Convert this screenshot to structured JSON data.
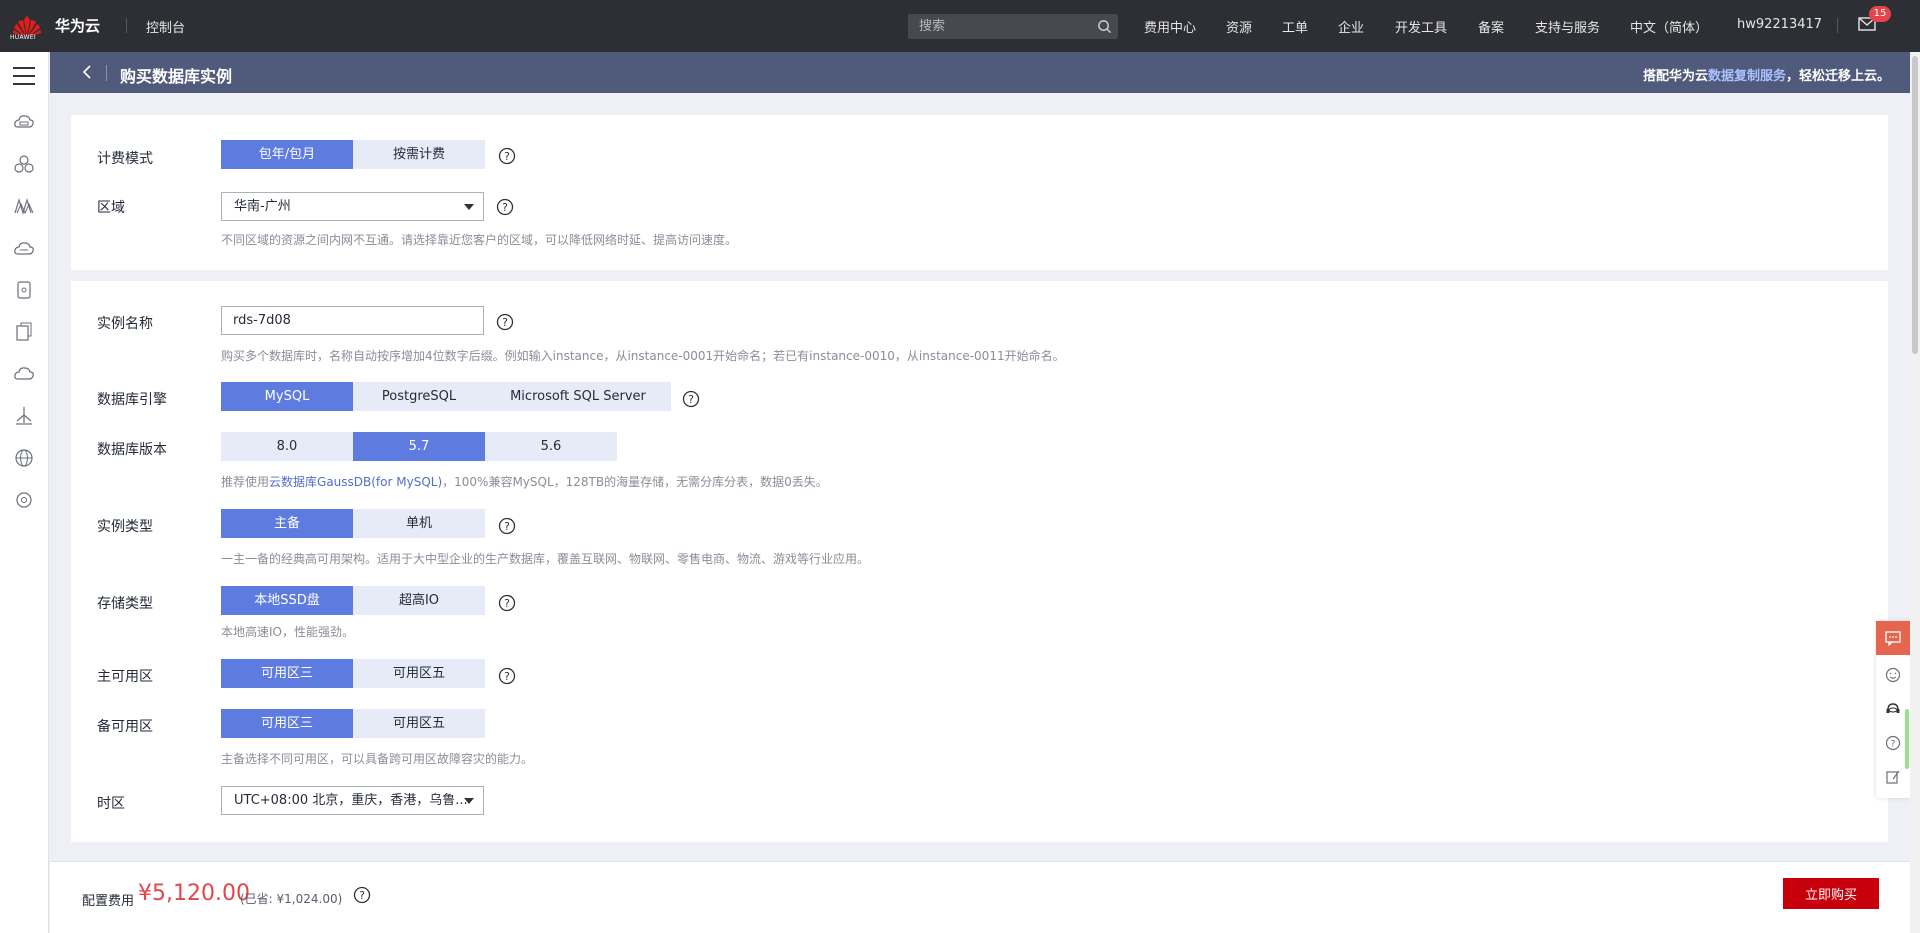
{
  "topbar": {
    "brand": "华为云",
    "logo_text": "HUAWEI",
    "console": "控制台",
    "search_placeholder": "搜索",
    "nav": [
      "费用中心",
      "资源",
      "工单",
      "企业",
      "开发工具",
      "备案",
      "支持与服务",
      "中文（简体）",
      "hw92213417"
    ],
    "mail_count": "15"
  },
  "rail": {
    "icons": [
      "cloud-server-icon",
      "cluster-icon",
      "network-icon",
      "cloud-storage-icon",
      "database-icon",
      "document-icon",
      "cloud-icon",
      "deploy-icon",
      "globe-icon",
      "ai-icon"
    ]
  },
  "page": {
    "title": "购买数据库实例",
    "promo_prefix": "搭配华为云",
    "promo_link": "数据复制服务",
    "promo_suffix": "，轻松迁移上云。"
  },
  "billing": {
    "label": "计费模式",
    "options": [
      "包年/包月",
      "按需计费"
    ],
    "selected": "包年/包月"
  },
  "region": {
    "label": "区域",
    "value": "华南-广州",
    "hint": "不同区域的资源之间内网不互通。请选择靠近您客户的区域，可以降低网络时延、提高访问速度。"
  },
  "instance_name": {
    "label": "实例名称",
    "value": "rds-7d08",
    "hint": "购买多个数据库时，名称自动按序增加4位数字后缀。例如输入instance，从instance-0001开始命名；若已有instance-0010，从instance-0011开始命名。"
  },
  "engine": {
    "label": "数据库引擎",
    "options": [
      "MySQL",
      "PostgreSQL",
      "Microsoft SQL Server"
    ],
    "selected": "MySQL"
  },
  "version": {
    "label": "数据库版本",
    "options": [
      "8.0",
      "5.7",
      "5.6"
    ],
    "selected": "5.7",
    "hint_prefix": "推荐使用",
    "hint_link": "云数据库GaussDB(for MySQL)",
    "hint_suffix": "，100%兼容MySQL，128TB的海量存储，无需分库分表，数据0丢失。"
  },
  "instance_type": {
    "label": "实例类型",
    "options": [
      "主备",
      "单机"
    ],
    "selected": "主备",
    "hint": "一主一备的经典高可用架构。适用于大中型企业的生产数据库，覆盖互联网、物联网、零售电商、物流、游戏等行业应用。"
  },
  "storage": {
    "label": "存储类型",
    "options": [
      "本地SSD盘",
      "超高IO"
    ],
    "selected": "本地SSD盘",
    "hint": "本地高速IO，性能强劲。"
  },
  "primary_az": {
    "label": "主可用区",
    "options": [
      "可用区三",
      "可用区五"
    ],
    "selected": "可用区三"
  },
  "standby_az": {
    "label": "备可用区",
    "options": [
      "可用区三",
      "可用区五"
    ],
    "selected": "可用区三",
    "hint": "主备选择不同可用区，可以具备跨可用区故障容灾的能力。"
  },
  "timezone": {
    "label": "时区",
    "value": "UTC+08:00 北京，重庆，香港，乌鲁..."
  },
  "footer": {
    "fee_label": "配置费用",
    "fee_value": "¥5,120.00",
    "fee_save": "(已省: ¥1,024.00)",
    "buy_label": "立即购买"
  },
  "colors": {
    "accent": "#5e7ce0",
    "buy": "#c7000b",
    "price": "#e5454a",
    "header": "#505a7a",
    "topbar": "#2d2f35"
  }
}
